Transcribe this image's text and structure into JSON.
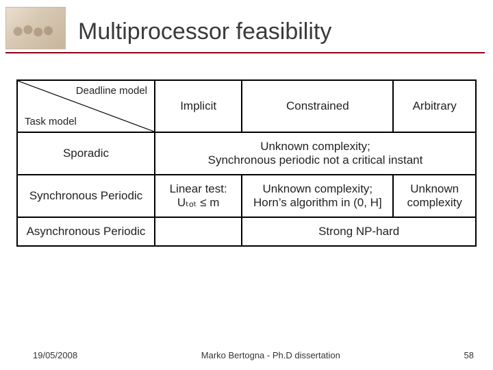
{
  "title": "Multiprocessor feasibility",
  "header": {
    "diag_top": "Deadline model",
    "diag_bottom": "Task model",
    "cols": [
      "Implicit",
      "Constrained",
      "Arbitrary"
    ]
  },
  "rows": {
    "sporadic": {
      "label": "Sporadic",
      "merged": "Unknown complexity;\nSynchronous periodic not a critical instant"
    },
    "sync": {
      "label": "Synchronous Periodic",
      "c1_line1": "Linear test:",
      "c1_line2": "Uₜₒₜ ≤ m",
      "c2_line1": "Unknown complexity;",
      "c2_line2": "Horn’s algorithm in (0, H]",
      "c3_line1": "Unknown",
      "c3_line2": "complexity"
    },
    "async": {
      "label": "Asynchronous Periodic",
      "blank": "",
      "merged": "Strong NP-hard"
    }
  },
  "footer": {
    "date": "19/05/2008",
    "center": "Marko Bertogna - Ph.D dissertation",
    "page": "58"
  }
}
